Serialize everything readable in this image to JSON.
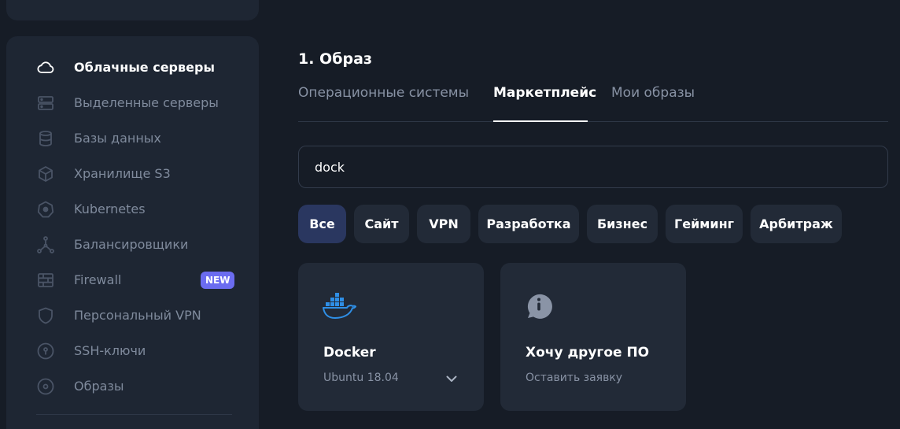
{
  "sidebar": {
    "items": [
      {
        "label": "Облачные серверы",
        "icon": "cloud-icon",
        "active": true
      },
      {
        "label": "Выделенные серверы",
        "icon": "server-icon"
      },
      {
        "label": "Базы данных",
        "icon": "database-icon"
      },
      {
        "label": "Хранилище S3",
        "icon": "cube-icon"
      },
      {
        "label": "Kubernetes",
        "icon": "kubernetes-icon"
      },
      {
        "label": "Балансировщики",
        "icon": "load-balancer-icon"
      },
      {
        "label": "Firewall",
        "icon": "firewall-icon",
        "badge": "NEW"
      },
      {
        "label": "Персональный VPN",
        "icon": "shield-icon"
      },
      {
        "label": "SSH-ключи",
        "icon": "key-icon"
      },
      {
        "label": "Образы",
        "icon": "disc-icon"
      }
    ]
  },
  "main": {
    "section_title": "1. Образ",
    "tabs": [
      {
        "label": "Операционные системы"
      },
      {
        "label": "Маркетплейс",
        "active": true
      },
      {
        "label": "Мои образы"
      }
    ],
    "search": {
      "value": "dock"
    },
    "filters": [
      {
        "label": "Все",
        "active": true
      },
      {
        "label": "Сайт"
      },
      {
        "label": "VPN"
      },
      {
        "label": "Разработка"
      },
      {
        "label": "Бизнес"
      },
      {
        "label": "Гейминг"
      },
      {
        "label": "Арбитраж"
      }
    ],
    "cards": [
      {
        "title": "Docker",
        "subtitle": "Ubuntu 18.04",
        "icon": "docker-icon"
      },
      {
        "title": "Хочу другое ПО",
        "subtitle": "Оставить заявку",
        "icon": "info-bubble-icon"
      }
    ]
  },
  "colors": {
    "background": "#161c26",
    "panel": "#1e2633",
    "chip": "#222a37",
    "chip_active": "#2a3760",
    "badge": "#6b6cf0",
    "docker_blue": "#2f8fe6",
    "muted_text": "#8892a4"
  }
}
